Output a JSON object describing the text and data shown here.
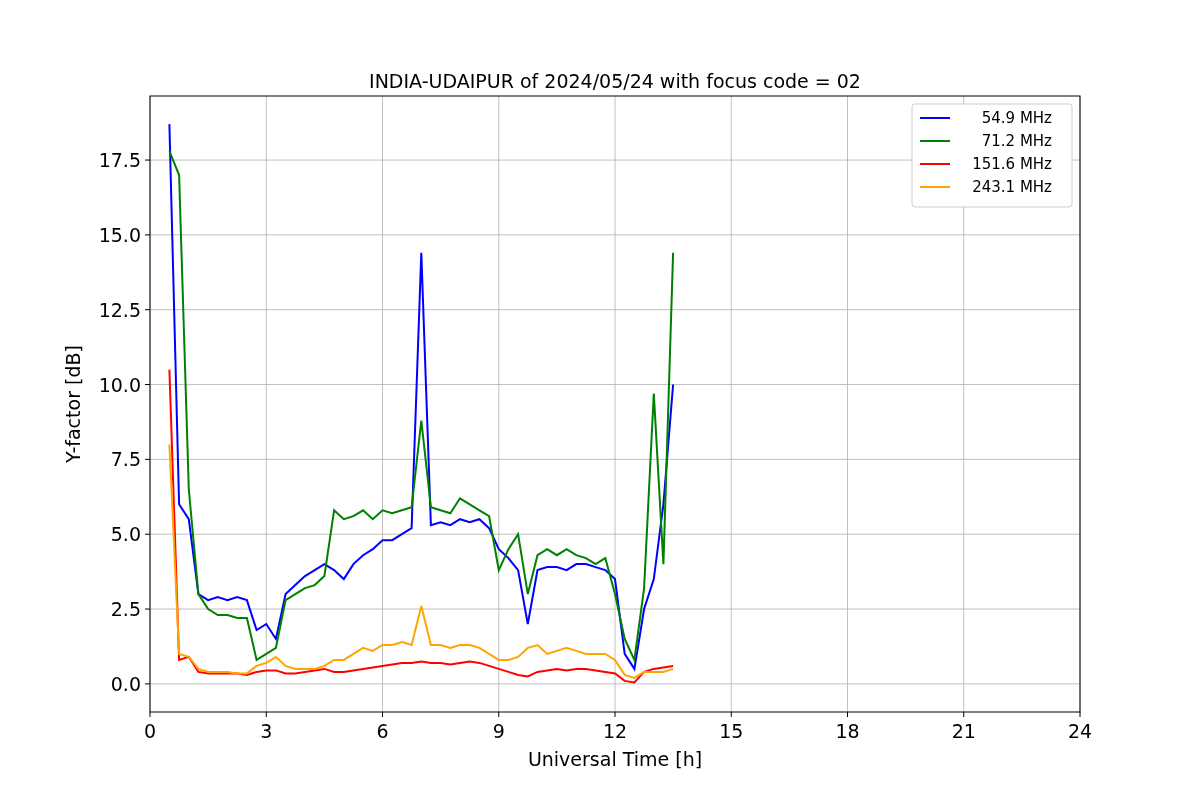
{
  "chart_data": {
    "type": "line",
    "title": "INDIA-UDAIPUR of 2024/05/24 with focus code = 02",
    "xlabel": "Universal Time [h]",
    "ylabel": "Y-factor [dB]",
    "x": [
      0.5,
      0.75,
      1.0,
      1.25,
      1.5,
      1.75,
      2.0,
      2.25,
      2.5,
      2.75,
      3.0,
      3.25,
      3.5,
      3.75,
      4.0,
      4.25,
      4.5,
      4.75,
      5.0,
      5.25,
      5.5,
      5.75,
      6.0,
      6.25,
      6.5,
      6.75,
      7.0,
      7.25,
      7.5,
      7.75,
      8.0,
      8.25,
      8.5,
      8.75,
      9.0,
      9.25,
      9.5,
      9.75,
      10.0,
      10.25,
      10.5,
      10.75,
      11.0,
      11.25,
      11.5,
      11.75,
      12.0,
      12.25,
      12.5,
      12.75,
      13.0,
      13.25,
      13.5
    ],
    "series": [
      {
        "name": "54.9 MHz",
        "color": "#0000ff",
        "values": [
          18.7,
          6.0,
          5.5,
          3.0,
          2.8,
          2.9,
          2.8,
          2.9,
          2.8,
          1.8,
          2.0,
          1.5,
          3.0,
          3.3,
          3.6,
          3.8,
          4.0,
          3.8,
          3.5,
          4.0,
          4.3,
          4.5,
          4.8,
          4.8,
          5.0,
          5.2,
          14.4,
          5.3,
          5.4,
          5.3,
          5.5,
          5.4,
          5.5,
          5.2,
          4.5,
          4.2,
          3.8,
          2.0,
          3.8,
          3.9,
          3.9,
          3.8,
          4.0,
          4.0,
          3.9,
          3.8,
          3.5,
          1.0,
          0.5,
          2.5,
          3.5,
          6.0,
          10.0
        ]
      },
      {
        "name": "71.2 MHz",
        "color": "#008000",
        "values": [
          17.8,
          17.0,
          6.5,
          3.0,
          2.5,
          2.3,
          2.3,
          2.2,
          2.2,
          0.8,
          1.0,
          1.2,
          2.8,
          3.0,
          3.2,
          3.3,
          3.6,
          5.8,
          5.5,
          5.6,
          5.8,
          5.5,
          5.8,
          5.7,
          5.8,
          5.9,
          8.8,
          5.9,
          5.8,
          5.7,
          6.2,
          6.0,
          5.8,
          5.6,
          3.8,
          4.5,
          5.0,
          3.0,
          4.3,
          4.5,
          4.3,
          4.5,
          4.3,
          4.2,
          4.0,
          4.2,
          3.0,
          1.5,
          0.8,
          3.2,
          9.7,
          4.0,
          14.4
        ]
      },
      {
        "name": "151.6 MHz",
        "color": "#ff0000",
        "values": [
          10.5,
          0.8,
          0.9,
          0.4,
          0.35,
          0.35,
          0.35,
          0.35,
          0.3,
          0.4,
          0.45,
          0.45,
          0.35,
          0.35,
          0.4,
          0.45,
          0.5,
          0.4,
          0.4,
          0.45,
          0.5,
          0.55,
          0.6,
          0.65,
          0.7,
          0.7,
          0.75,
          0.7,
          0.7,
          0.65,
          0.7,
          0.75,
          0.7,
          0.6,
          0.5,
          0.4,
          0.3,
          0.25,
          0.4,
          0.45,
          0.5,
          0.45,
          0.5,
          0.5,
          0.45,
          0.4,
          0.35,
          0.1,
          0.05,
          0.4,
          0.5,
          0.55,
          0.6
        ]
      },
      {
        "name": "243.1 MHz",
        "color": "#ffa500",
        "values": [
          8.0,
          1.0,
          0.9,
          0.5,
          0.4,
          0.4,
          0.4,
          0.35,
          0.35,
          0.6,
          0.7,
          0.9,
          0.6,
          0.5,
          0.5,
          0.5,
          0.6,
          0.8,
          0.8,
          1.0,
          1.2,
          1.1,
          1.3,
          1.3,
          1.4,
          1.3,
          2.6,
          1.3,
          1.3,
          1.2,
          1.3,
          1.3,
          1.2,
          1.0,
          0.8,
          0.8,
          0.9,
          1.2,
          1.3,
          1.0,
          1.1,
          1.2,
          1.1,
          1.0,
          1.0,
          1.0,
          0.8,
          0.3,
          0.2,
          0.4,
          0.4,
          0.4,
          0.5
        ]
      }
    ],
    "grid": true,
    "legend": true,
    "xlim": [
      0,
      24
    ],
    "ylim": [
      -0.94,
      19.64
    ],
    "xticks": [
      0,
      3,
      6,
      9,
      12,
      15,
      18,
      21,
      24
    ],
    "yticks": [
      {
        "value": 0,
        "label": "0.0"
      },
      {
        "value": 2.5,
        "label": "2.5"
      },
      {
        "value": 5,
        "label": "5.0"
      },
      {
        "value": 7.5,
        "label": "7.5"
      },
      {
        "value": 10,
        "label": "10.0"
      },
      {
        "value": 12.5,
        "label": "12.5"
      },
      {
        "value": 15,
        "label": "15.0"
      },
      {
        "value": 17.5,
        "label": "17.5"
      }
    ]
  }
}
